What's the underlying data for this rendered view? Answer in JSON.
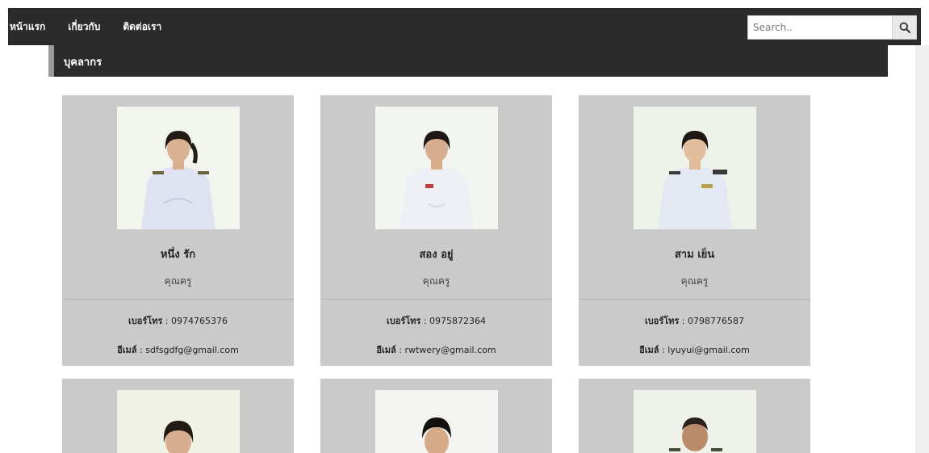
{
  "nav": {
    "items": [
      {
        "label": "หน้าแรก"
      },
      {
        "label": "เกี่ยวกับ"
      },
      {
        "label": "ติดต่อเรา"
      }
    ],
    "search": {
      "placeholder": "Search..",
      "icon": "search-icon"
    }
  },
  "section": {
    "title": "บุคลากร"
  },
  "labels": {
    "phone": "เบอร์โทร",
    "email": "อีเมล์"
  },
  "staff": [
    {
      "name": "หนึ่ง รัก",
      "role": "คุณครู",
      "phone": "0974765376",
      "email": "sdfsgdfg@gmail.com"
    },
    {
      "name": "สอง อยู่",
      "role": "คุณครู",
      "phone": "0975872364",
      "email": "rwtwery@gmail.com"
    },
    {
      "name": "สาม เย็น",
      "role": "คุณครู",
      "phone": "0798776587",
      "email": "lyuyui@gmail.com"
    }
  ],
  "colors": {
    "navbar": "#2b2b2b",
    "card": "#cacaca",
    "header_accent": "#9a9a9a"
  }
}
